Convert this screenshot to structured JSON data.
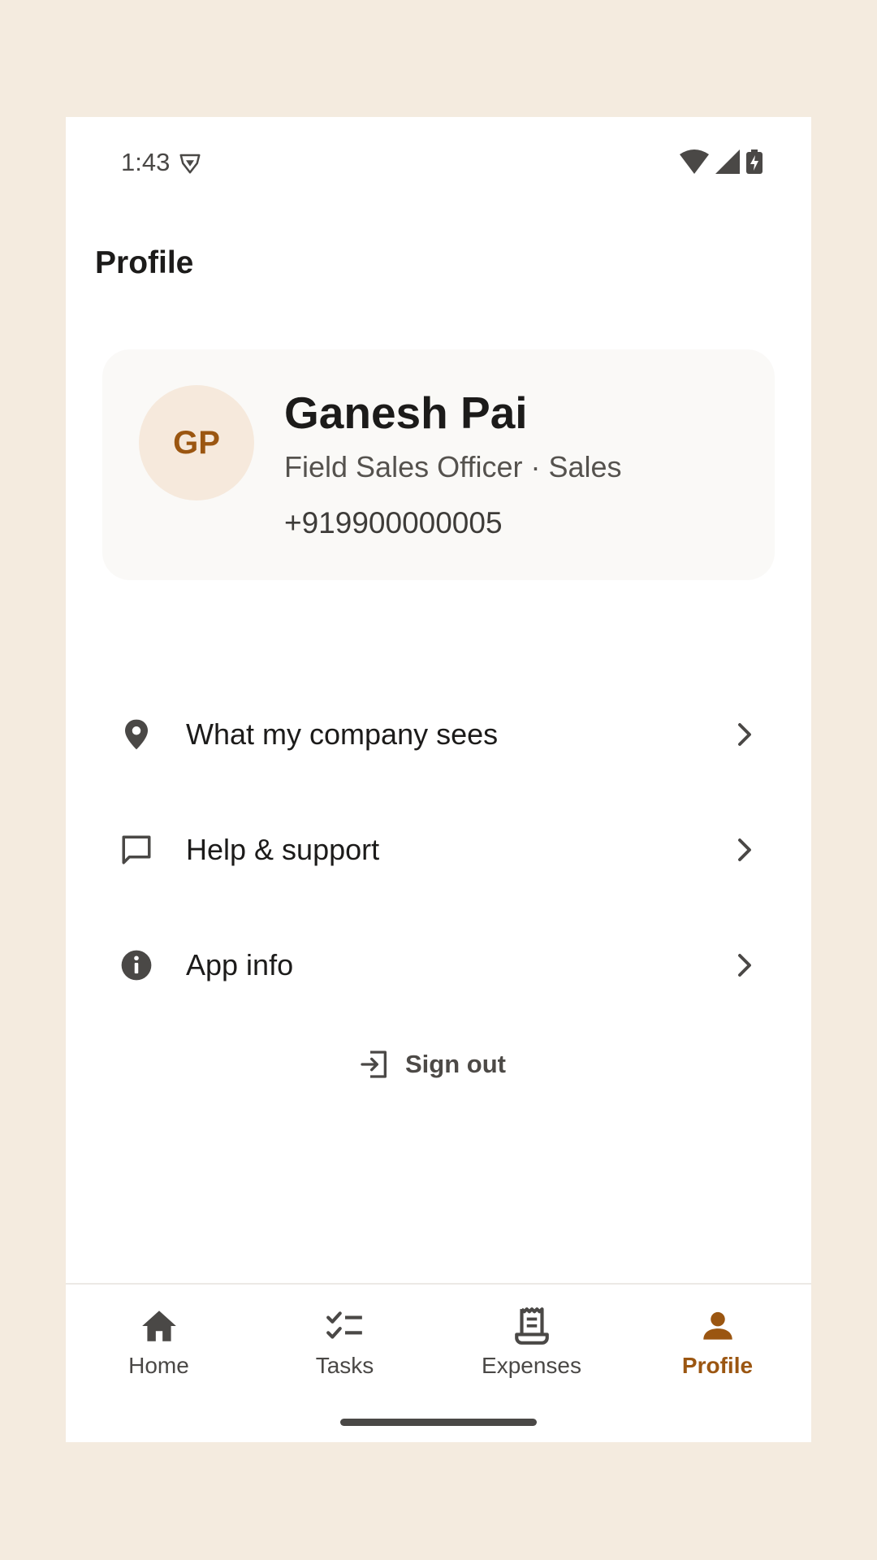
{
  "status_bar": {
    "time": "1:43",
    "icons": [
      "vpn-shield-icon",
      "wifi-icon",
      "cell-signal-icon",
      "battery-charging-icon"
    ]
  },
  "header": {
    "title": "Profile"
  },
  "profile": {
    "initials": "GP",
    "name": "Ganesh Pai",
    "role": "Field Sales Officer · Sales",
    "phone": "+919900000005"
  },
  "menu": {
    "items": [
      {
        "label": "What my company sees",
        "icon": "location-pin-icon"
      },
      {
        "label": "Help & support",
        "icon": "chat-bubble-icon"
      },
      {
        "label": "App info",
        "icon": "info-icon"
      }
    ]
  },
  "actions": {
    "sign_out_label": "Sign out",
    "sign_out_icon": "sign-out-icon"
  },
  "bottom_nav": {
    "items": [
      {
        "label": "Home",
        "icon": "home-icon"
      },
      {
        "label": "Tasks",
        "icon": "tasks-icon"
      },
      {
        "label": "Expenses",
        "icon": "receipt-icon"
      },
      {
        "label": "Profile",
        "icon": "person-icon"
      }
    ],
    "active": "Profile"
  },
  "colors": {
    "accent": "#9b5611",
    "background": "#f4ebdf",
    "avatar_bg": "#f6e9dc",
    "card_bg": "#faf9f7",
    "icon": "#4a4846"
  }
}
